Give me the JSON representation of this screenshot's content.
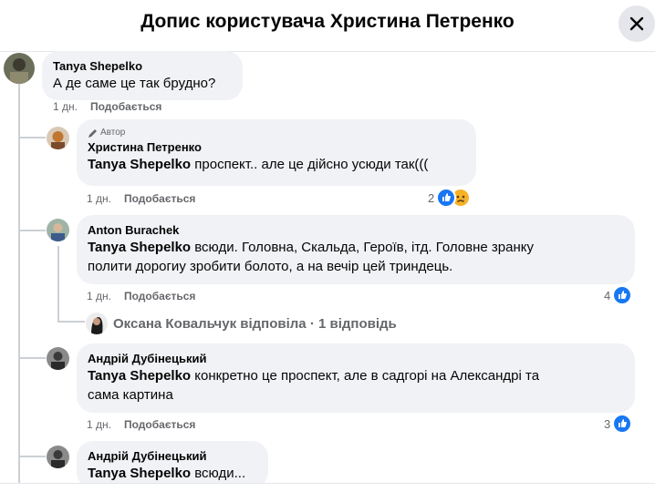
{
  "header": {
    "title": "Допис користувача Христина Петренко"
  },
  "comments": [
    {
      "author": "Tanya Shepelko",
      "text": "А де саме це так брудно?",
      "time": "1 дн.",
      "like": "Подобається"
    },
    {
      "badge": "Автор",
      "author": "Христина Петренко",
      "mention": "Tanya Shepelko",
      "text": " проспект.. але це дійсно усюди так(((",
      "time": "1 дн.",
      "like": "Подобається",
      "reaction_count": "2",
      "reaction_icons": [
        "like-icon",
        "sad-icon"
      ]
    },
    {
      "author": "Anton Burachek",
      "mention": "Tanya Shepelko",
      "text_line1": " всюди. Головна, Скальда, Героїв, ітд. Головне зранку",
      "text_line2": "полити дорогиу зробити болото, а на вечір цей триндець.",
      "time": "1 дн.",
      "like": "Подобається",
      "reaction_count": "4",
      "reaction_icons": [
        "like-icon"
      ],
      "replies_summary": "Оксана Ковальчук відповіла · 1 відповідь"
    },
    {
      "author": "Андрій Дубінецький",
      "mention": "Tanya Shepelko",
      "text_line1": " конкретно це проспект, але в садгорі на Александрі та",
      "text_line2": "сама картина",
      "time": "1 дн.",
      "like": "Подобається",
      "reaction_count": "3",
      "reaction_icons": [
        "like-icon"
      ]
    },
    {
      "author": "Андрій Дубінецький",
      "mention": "Tanya Shepelko",
      "text": " всюди..."
    }
  ],
  "colors": {
    "bubble": "#f0f2f5",
    "meta": "#65676b",
    "like_blue": "#1877f2",
    "sad_yellow": "#f7b125"
  }
}
